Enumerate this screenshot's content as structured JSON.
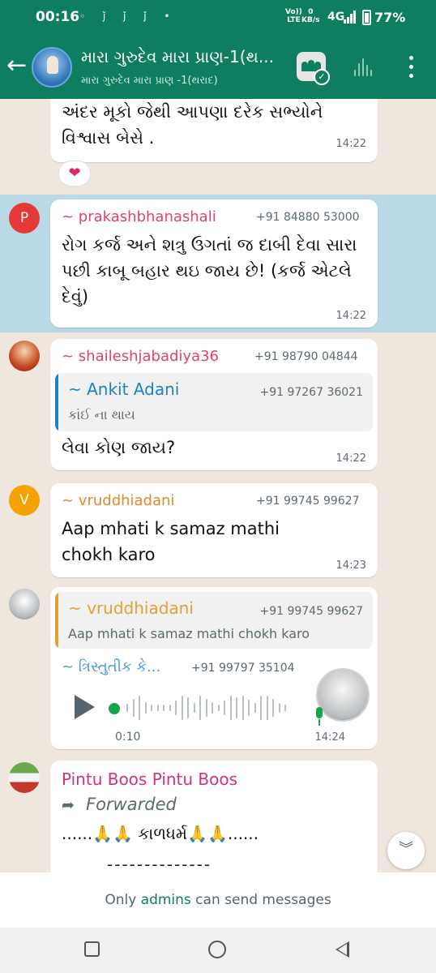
{
  "status_bar": {
    "time": "00:16",
    "notification_glyphs": "◦ ǰ ǰ ǰ •",
    "volte_line1": "Vo))",
    "volte_line2": "LTE",
    "speed_value": "0",
    "speed_unit": "KB/s",
    "network": "4G",
    "battery": "77%"
  },
  "header": {
    "group_name": "મારા ગુરુદેવ મારા પ્રાણ-1(થ...",
    "group_subtitle": "મારા ગુરુદેવ મારા પ્રાણ -1(થરાદ)",
    "back_icon": "←",
    "community_check": "✓"
  },
  "messages": [
    {
      "id": "m1",
      "body": "અંદર મૂકો જેથી આપણા દરેક સભ્યોને વિશ્વાસ બેસે .",
      "time": "14:22",
      "reaction": "❤"
    },
    {
      "id": "m2",
      "avatar_letter": "P",
      "sender": "~ prakashbhanashali",
      "phone": "+91 84880 53000",
      "body": "રોગ કર્જ અને શત્રુ ઉગતાં જ દાબી દેવા સારા પછી કાબૂ બહાર થઇ જાય છે! (કર્જ એટલે દેવું)",
      "time": "14:22"
    },
    {
      "id": "m3",
      "sender": "~ shaileshjabadiya36",
      "phone": "+91 98790 04844",
      "quote_name": "~ Ankit Adani",
      "quote_phone": "+91 97267 36021",
      "quote_text": "કાંઈ ના થાય",
      "body": "લેવા કોણ જાય?",
      "time": "14:22"
    },
    {
      "id": "m4",
      "avatar_letter": "V",
      "sender": "~ vruddhiadani",
      "phone": "+91 99745 99627",
      "body": "Aap mhati k samaz mathi chokh karo",
      "time": "14:23"
    },
    {
      "id": "m5",
      "quote_name": "~ vruddhiadani",
      "quote_phone": "+91 99745 99627",
      "quote_text": "Aap mhati k samaz mathi chokh karo",
      "sender": "~ ત્રિસ્તુતીક કે...",
      "phone": "+91 99797 35104",
      "voice_duration": "0:10",
      "time": "14:24"
    },
    {
      "id": "m6",
      "sender": "Pintu Boos Pintu Boos",
      "forwarded": "Forwarded",
      "forward_icon": "➦",
      "body": "......🙏🙏 કાળધર્મ🙏🙏......",
      "dashes": "--------------"
    }
  ],
  "scroll_icon": "︾",
  "footer": {
    "prefix": "Only ",
    "admins": "admins",
    "suffix": " can send messages"
  },
  "colors": {
    "header_green": "#0f7d5f",
    "chat_bg": "#efe7de",
    "highlight": "#b8d9e5",
    "prakash_name": "#e0426b",
    "shailesh_name": "#e0426b",
    "ankit_name": "#1f7fc8",
    "vruddhi_name": "#e0892a",
    "voice_sender": "#4a9bd6",
    "pintu_name": "#d4317a",
    "avatar_p": "#e53935",
    "avatar_v": "#f4a300"
  }
}
